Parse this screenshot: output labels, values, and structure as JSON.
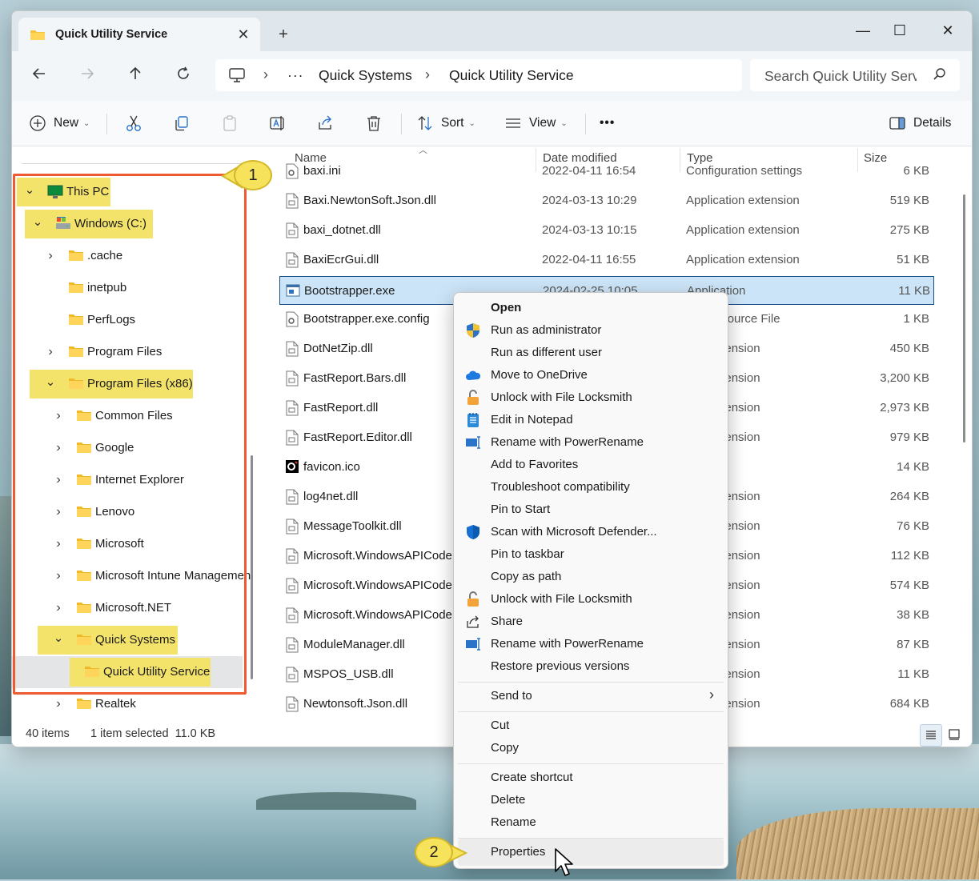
{
  "tab": {
    "title": "Quick Utility Service",
    "close": "✕",
    "new_tab": "+"
  },
  "window_controls": {
    "minimize": "—",
    "maximize": "☐",
    "close": "✕"
  },
  "address": {
    "ellipsis": "···",
    "breadcrumbs": [
      "Quick Systems",
      "Quick Utility Service"
    ],
    "separator": "›",
    "search_placeholder": "Search Quick Utility Serv"
  },
  "toolbar": {
    "new_label": "New",
    "sort_label": "Sort",
    "view_label": "View",
    "more_label": "•••",
    "details_label": "Details"
  },
  "tree": [
    {
      "label": "This PC",
      "icon": "monitor-icon",
      "expanded": true
    },
    {
      "label": "Windows (C:)",
      "icon": "drive-icon",
      "expanded": true
    },
    {
      "label": ".cache",
      "icon": "folder-icon"
    },
    {
      "label": "inetpub",
      "icon": "folder-icon"
    },
    {
      "label": "PerfLogs",
      "icon": "folder-icon"
    },
    {
      "label": "Program Files",
      "icon": "folder-icon"
    },
    {
      "label": "Program Files (x86)",
      "icon": "folder-icon",
      "expanded": true
    },
    {
      "label": "Common Files",
      "icon": "folder-icon"
    },
    {
      "label": "Google",
      "icon": "folder-icon"
    },
    {
      "label": "Internet Explorer",
      "icon": "folder-icon"
    },
    {
      "label": "Lenovo",
      "icon": "folder-icon"
    },
    {
      "label": "Microsoft",
      "icon": "folder-icon"
    },
    {
      "label": "Microsoft Intune Managemen",
      "icon": "folder-icon"
    },
    {
      "label": "Microsoft.NET",
      "icon": "folder-icon"
    },
    {
      "label": "Quick Systems",
      "icon": "folder-icon",
      "expanded": true
    },
    {
      "label": "Quick Utility Service",
      "icon": "folder-icon",
      "selected": true
    },
    {
      "label": "Realtek",
      "icon": "folder-icon"
    }
  ],
  "columns": {
    "name": "Name",
    "date": "Date modified",
    "type": "Type",
    "size": "Size"
  },
  "files": [
    {
      "name": "baxi.ini",
      "date": "2022-04-11 16:54",
      "type": "Configuration settings",
      "size": "6 KB",
      "icon": "settings-file-icon"
    },
    {
      "name": "Baxi.NewtonSoft.Json.dll",
      "date": "2024-03-13 10:29",
      "type": "Application extension",
      "size": "519 KB",
      "icon": "dll-file-icon"
    },
    {
      "name": "baxi_dotnet.dll",
      "date": "2024-03-13 10:15",
      "type": "Application extension",
      "size": "275 KB",
      "icon": "dll-file-icon"
    },
    {
      "name": "BaxiEcrGui.dll",
      "date": "2022-04-11 16:55",
      "type": "Application extension",
      "size": "51 KB",
      "icon": "dll-file-icon"
    },
    {
      "name": "Bootstrapper.exe",
      "date": "2024-02-25 10:05",
      "type": "Application",
      "size": "11 KB",
      "icon": "exe-file-icon",
      "selected": true
    },
    {
      "name": "Bootstrapper.exe.config",
      "date": "",
      "type": "ration Source File",
      "size": "1 KB",
      "icon": "settings-file-icon"
    },
    {
      "name": "DotNetZip.dll",
      "date": "",
      "type": "tion extension",
      "size": "450 KB",
      "icon": "dll-file-icon"
    },
    {
      "name": "FastReport.Bars.dll",
      "date": "",
      "type": "tion extension",
      "size": "3,200 KB",
      "icon": "dll-file-icon"
    },
    {
      "name": "FastReport.dll",
      "date": "",
      "type": "tion extension",
      "size": "2,973 KB",
      "icon": "dll-file-icon"
    },
    {
      "name": "FastReport.Editor.dll",
      "date": "",
      "type": "tion extension",
      "size": "979 KB",
      "icon": "dll-file-icon"
    },
    {
      "name": "favicon.ico",
      "date": "",
      "type": "",
      "size": "14 KB",
      "icon": "ico-file-icon"
    },
    {
      "name": "log4net.dll",
      "date": "",
      "type": "tion extension",
      "size": "264 KB",
      "icon": "dll-file-icon"
    },
    {
      "name": "MessageToolkit.dll",
      "date": "",
      "type": "tion extension",
      "size": "76 KB",
      "icon": "dll-file-icon"
    },
    {
      "name": "Microsoft.WindowsAPICodeP",
      "date": "",
      "type": "tion extension",
      "size": "112 KB",
      "icon": "dll-file-icon"
    },
    {
      "name": "Microsoft.WindowsAPICodeP",
      "date": "",
      "type": "tion extension",
      "size": "574 KB",
      "icon": "dll-file-icon"
    },
    {
      "name": "Microsoft.WindowsAPICodeP",
      "date": "",
      "type": "tion extension",
      "size": "38 KB",
      "icon": "dll-file-icon"
    },
    {
      "name": "ModuleManager.dll",
      "date": "",
      "type": "tion extension",
      "size": "87 KB",
      "icon": "dll-file-icon"
    },
    {
      "name": "MSPOS_USB.dll",
      "date": "",
      "type": "tion extension",
      "size": "11 KB",
      "icon": "dll-file-icon"
    },
    {
      "name": "Newtonsoft.Json.dll",
      "date": "",
      "type": "tion extension",
      "size": "684 KB",
      "icon": "dll-file-icon"
    }
  ],
  "status": {
    "items": "40 items",
    "selected": "1 item selected  11.0 KB"
  },
  "context_menu": {
    "groups": [
      [
        {
          "label": "Open",
          "icon": "",
          "bold": true
        },
        {
          "label": "Run as administrator",
          "icon": "uac-shield-icon"
        },
        {
          "label": "Run as different user",
          "icon": ""
        },
        {
          "label": "Move to OneDrive",
          "icon": "onedrive-cloud-icon"
        },
        {
          "label": "Unlock with File Locksmith",
          "icon": "padlock-icon"
        },
        {
          "label": "Edit in Notepad",
          "icon": "notepad-icon"
        },
        {
          "label": "Rename with PowerRename",
          "icon": "powerrename-icon"
        },
        {
          "label": "Add to Favorites",
          "icon": ""
        },
        {
          "label": "Troubleshoot compatibility",
          "icon": ""
        },
        {
          "label": "Pin to Start",
          "icon": ""
        },
        {
          "label": "Scan with Microsoft Defender...",
          "icon": "defender-shield-icon"
        },
        {
          "label": "Pin to taskbar",
          "icon": ""
        },
        {
          "label": "Copy as path",
          "icon": ""
        },
        {
          "label": "Unlock with File Locksmith",
          "icon": "padlock-icon"
        },
        {
          "label": "Share",
          "icon": "share-icon"
        },
        {
          "label": "Rename with PowerRename",
          "icon": "powerrename-icon"
        },
        {
          "label": "Restore previous versions",
          "icon": ""
        }
      ],
      [
        {
          "label": "Send to",
          "icon": "",
          "submenu": true
        }
      ],
      [
        {
          "label": "Cut",
          "icon": ""
        },
        {
          "label": "Copy",
          "icon": ""
        }
      ],
      [
        {
          "label": "Create shortcut",
          "icon": ""
        },
        {
          "label": "Delete",
          "icon": ""
        },
        {
          "label": "Rename",
          "icon": ""
        }
      ],
      [
        {
          "label": "Properties",
          "icon": "",
          "hover": true
        }
      ]
    ],
    "submenu_arrow": "›"
  },
  "callouts": {
    "one": "1",
    "two": "2"
  },
  "colors": {
    "callout_fill": "#f7e25c",
    "annotation_box": "#ee5a32",
    "selection_fill": "#cce4f7",
    "highlight": "#f4e36b"
  }
}
